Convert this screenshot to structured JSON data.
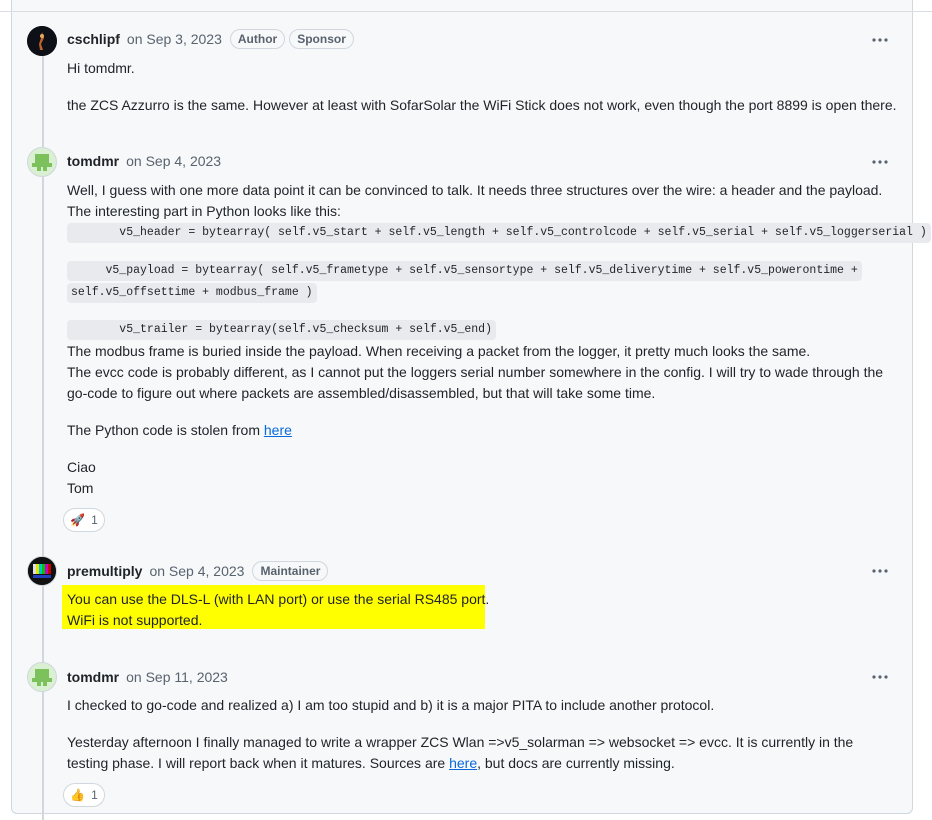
{
  "comments": [
    {
      "author": "cschlipf",
      "date": "on Sep 3, 2023",
      "badges": [
        "Author",
        "Sponsor"
      ],
      "avatar_icon": "lamp-avatar-icon",
      "lines": [
        "Hi tomdmr.",
        "the ZCS Azzurro is the same. However at least with SofarSolar the WiFi Stick does not work, even though the port 8899 is open there."
      ]
    },
    {
      "author": "tomdmr",
      "date": "on Sep 4, 2023",
      "avatar_icon": "green-pixel-avatar-icon",
      "intro_1": "Well, I guess with one more data point it can be convinced to talk. It needs three structures over the wire: a header and the payload.",
      "intro_2": "The interesting part in Python looks like this:",
      "code_header": "       v5_header = bytearray( self.v5_start + self.v5_length + self.v5_controlcode + self.v5_serial + self.v5_loggerserial )",
      "code_payload_1": "     v5_payload = bytearray( self.v5_frametype + self.v5_sensortype + self.v5_deliverytime + self.v5_powerontime +",
      "code_payload_2": "self.v5_offsettime + modbus_frame )",
      "code_trailer": "       v5_trailer = bytearray(self.v5_checksum + self.v5_end)",
      "after_1": "The modbus frame is buried inside the payload. When receiving a packet from the logger, it pretty much looks the same.",
      "after_2": "The evcc code is probably different, as I cannot put the loggers serial number somewhere in the config. I will try to wade through the",
      "after_3": "go-code to figure out where packets are assembled/disassembled, but that will take some time.",
      "source_text": "The Python code is stolen from ",
      "source_link": "here",
      "sign_1": "Ciao",
      "sign_2": "Tom",
      "reaction_emoji": "🚀",
      "reaction_icon": "rocket-icon",
      "reaction_count": "1"
    },
    {
      "author": "premultiply",
      "date": "on Sep 4, 2023",
      "badges": [
        "Maintainer"
      ],
      "avatar_icon": "test-pattern-avatar-icon",
      "line_1": "You can use the DLS-L (with LAN port) or use the serial RS485 port.",
      "line_2": "WiFi is not supported.",
      "highlight_color": "#ffff00"
    },
    {
      "author": "tomdmr",
      "date": "on Sep 11, 2023",
      "avatar_icon": "green-pixel-avatar-icon",
      "line_1": "I checked to go-code and realized a) I am too stupid and b) it is a major PITA to include another protocol.",
      "line_2": "Yesterday afternoon I finally managed to write a wrapper ZCS Wlan =>v5_solarman => websocket => evcc. It is currently in the",
      "line_3_before": "testing phase. I will report back when it matures. Sources are ",
      "line_3_link": "here",
      "line_3_after": ", but docs are currently missing.",
      "reaction_emoji": "👍",
      "reaction_icon": "thumbs-up-icon",
      "reaction_count": "1"
    }
  ],
  "colors": {
    "link": "#0969da",
    "background": "#f6f8fa",
    "border": "#d0d7de",
    "muted": "#59636e"
  }
}
